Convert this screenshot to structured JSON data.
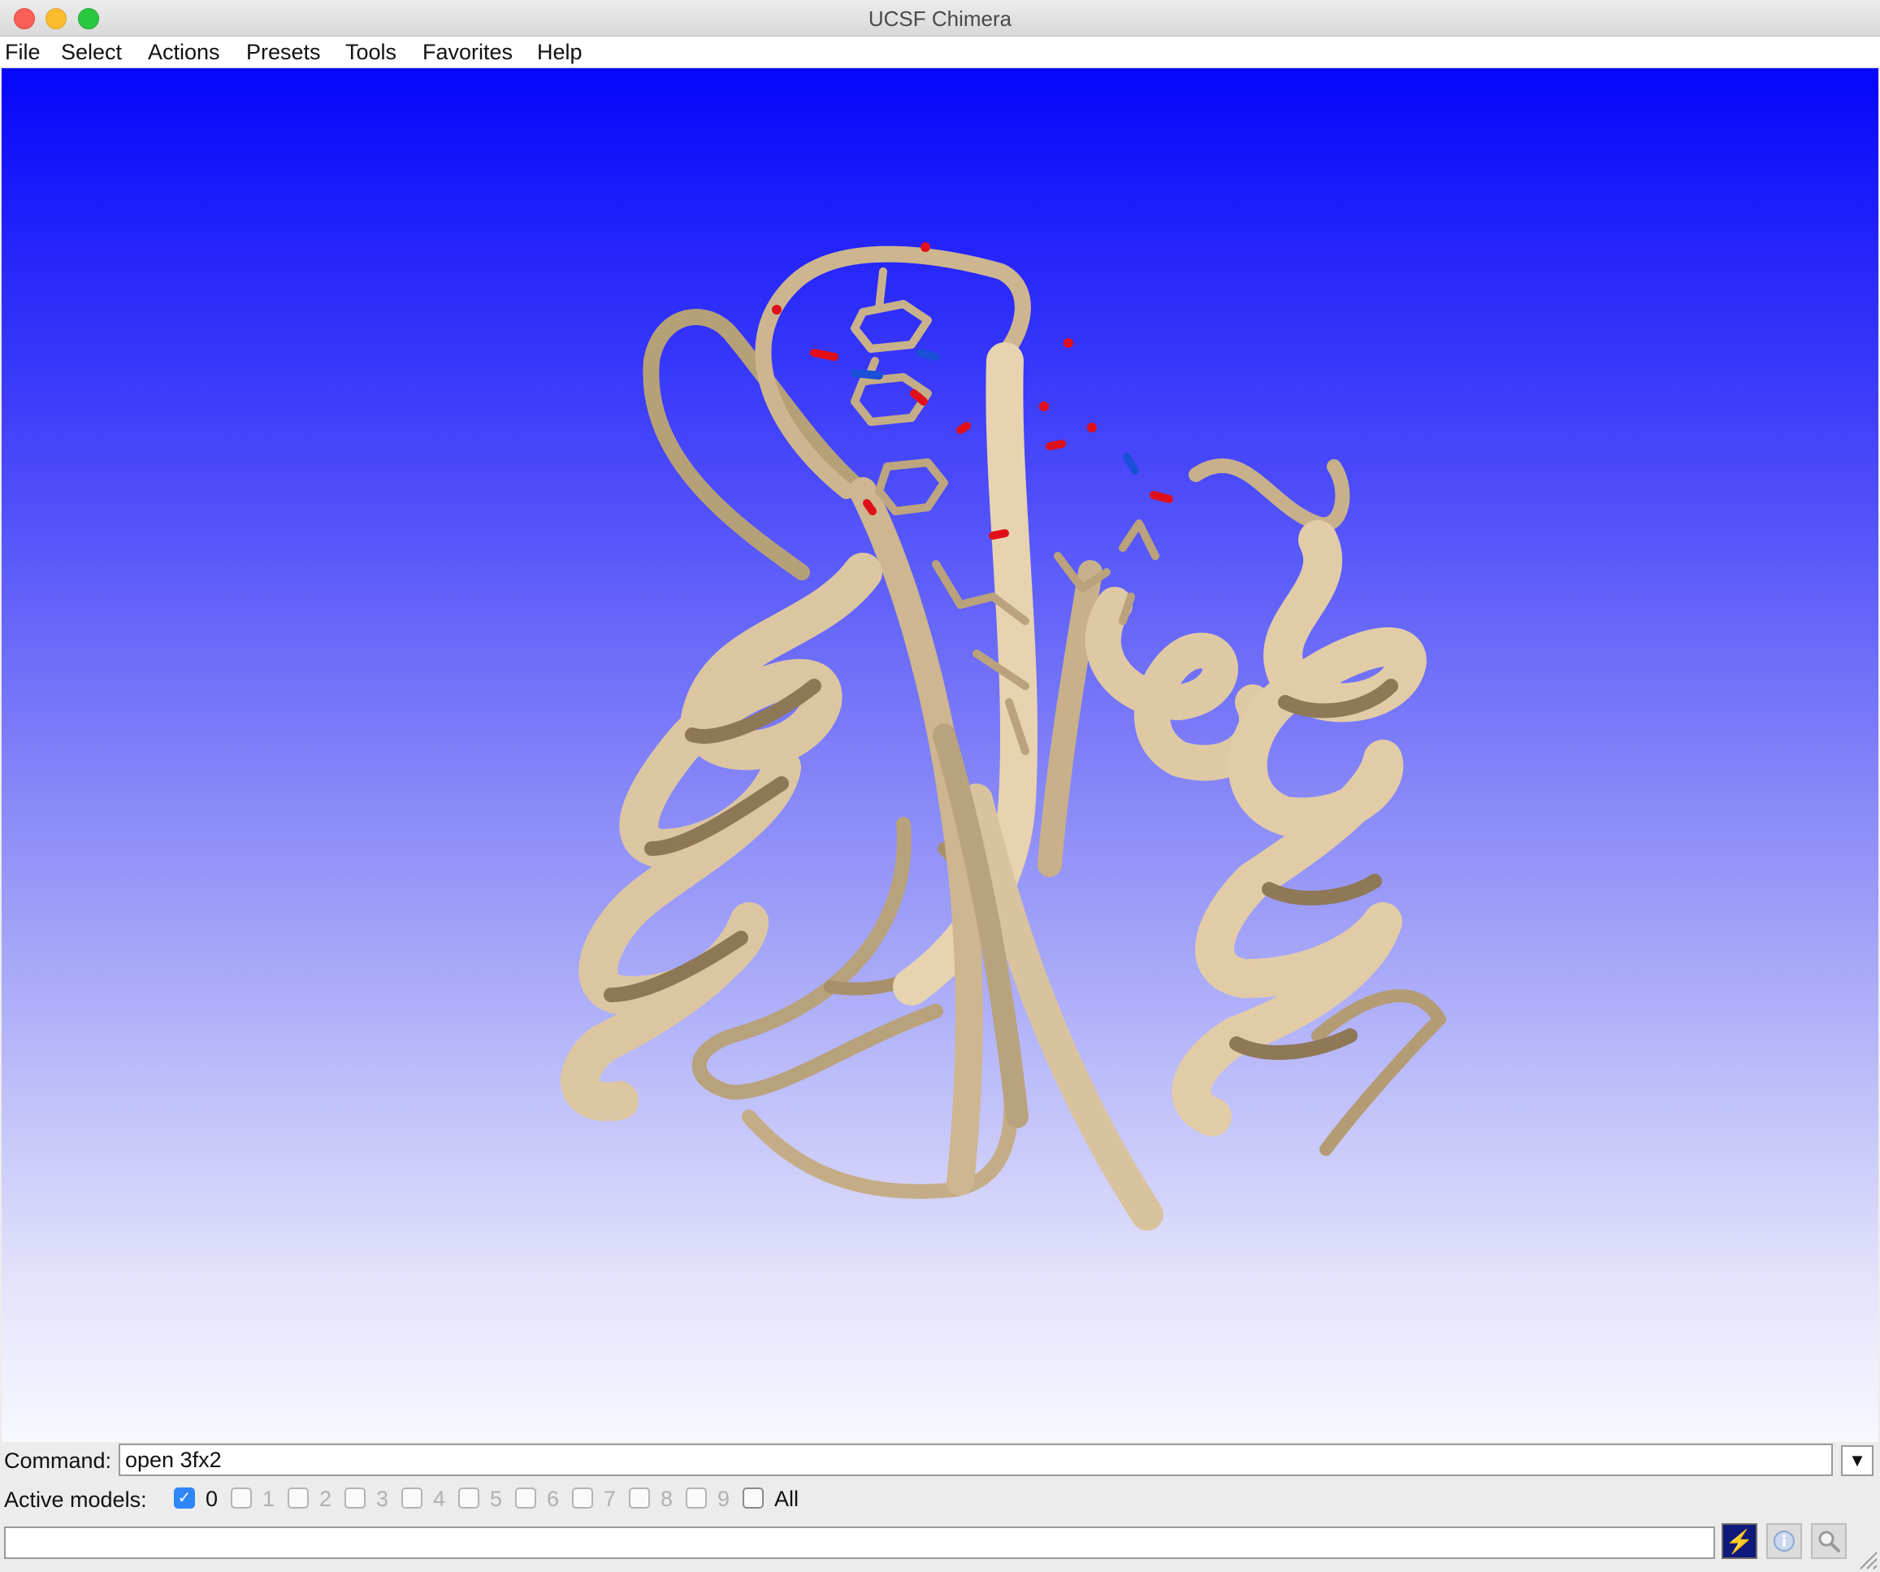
{
  "window": {
    "title": "UCSF Chimera"
  },
  "menu": {
    "items": [
      "File",
      "Select",
      "Actions",
      "Presets",
      "Tools",
      "Favorites",
      "Help"
    ]
  },
  "viewport": {
    "background_top": "#0606fb",
    "background_bottom": "#f8f8ff",
    "ribbon_color": "#d9c3a0",
    "oxygen_color": "#e0101a",
    "nitrogen_color": "#1a4fd8"
  },
  "command": {
    "label": "Command:",
    "value": "open 3fx2"
  },
  "active_models": {
    "label": "Active models:",
    "models": [
      {
        "label": "0",
        "checked": true,
        "enabled": true
      },
      {
        "label": "1",
        "checked": false,
        "enabled": false
      },
      {
        "label": "2",
        "checked": false,
        "enabled": false
      },
      {
        "label": "3",
        "checked": false,
        "enabled": false
      },
      {
        "label": "4",
        "checked": false,
        "enabled": false
      },
      {
        "label": "5",
        "checked": false,
        "enabled": false
      },
      {
        "label": "6",
        "checked": false,
        "enabled": false
      },
      {
        "label": "7",
        "checked": false,
        "enabled": false
      },
      {
        "label": "8",
        "checked": false,
        "enabled": false
      },
      {
        "label": "9",
        "checked": false,
        "enabled": false
      }
    ],
    "all_label": "All"
  },
  "status": {
    "text": "",
    "buttons": [
      "lightning-icon",
      "info-icon",
      "magnifier-icon"
    ]
  }
}
